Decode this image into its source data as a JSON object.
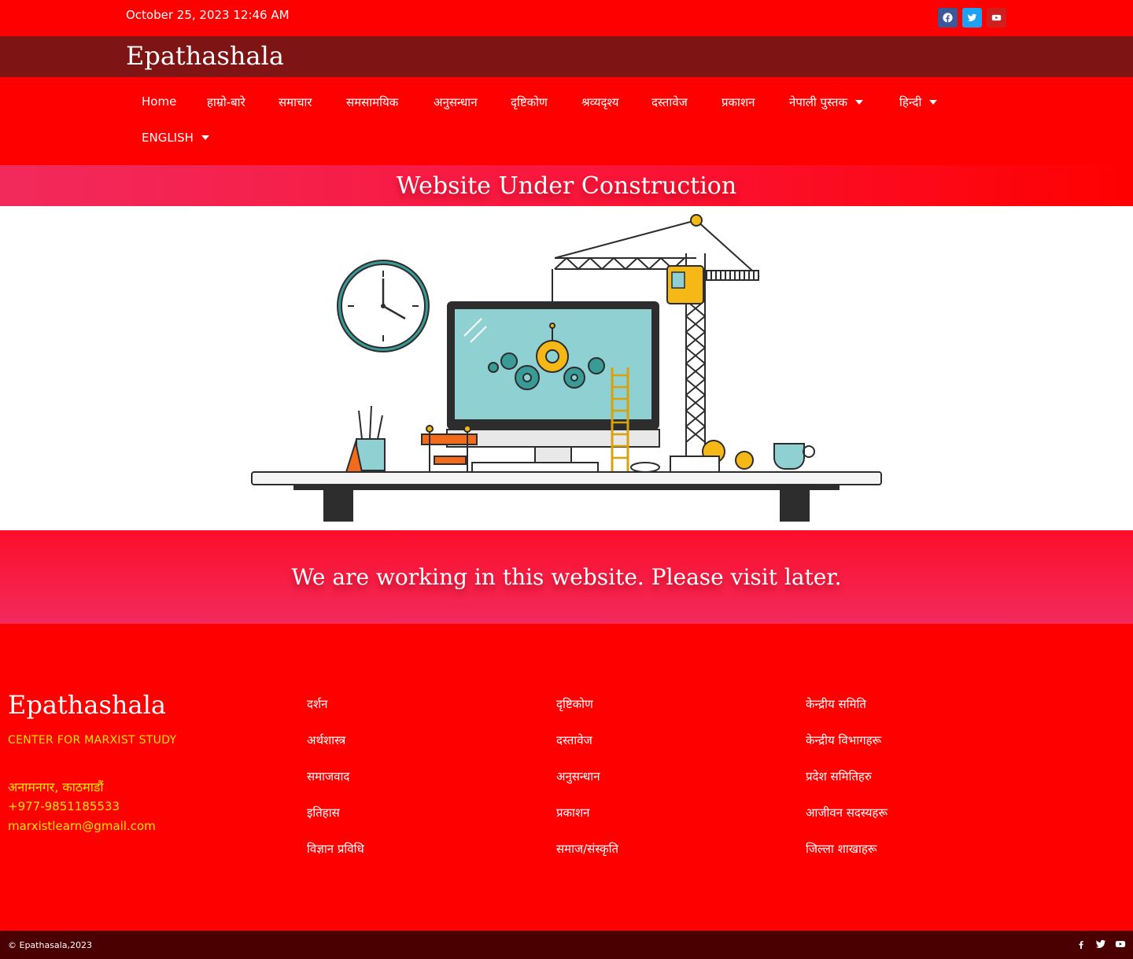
{
  "topbar": {
    "date": "October 25, 2023 12:46 AM",
    "social": [
      {
        "icon": "facebook-icon",
        "color": "#3b5998"
      },
      {
        "icon": "twitter-icon",
        "color": "#1da1f2"
      },
      {
        "icon": "youtube-icon",
        "color": "#cd201f"
      }
    ]
  },
  "site": {
    "name": "Epathashala"
  },
  "nav": {
    "items": [
      {
        "label": "Home"
      },
      {
        "label": "हाम्रो-बारे"
      },
      {
        "label": "समाचार"
      },
      {
        "label": "समसामयिक"
      },
      {
        "label": "अनुसन्धान"
      },
      {
        "label": "दृष्टिकोण"
      },
      {
        "label": "श्रव्यदृश्य"
      },
      {
        "label": "दस्तावेज"
      },
      {
        "label": "प्रकाशन"
      },
      {
        "label": "नेपाली पुस्तक",
        "dropdown": true
      },
      {
        "label": "हिन्दी",
        "dropdown": true
      },
      {
        "label": "ENGLISH",
        "dropdown": true
      }
    ]
  },
  "hero": {
    "title": "Website Under Construction",
    "message": "We are working in this website. Please visit later."
  },
  "footer": {
    "brand": "Epathashala",
    "subtitle": "CENTER FOR MARXIST STUDY",
    "address": "अनामनगर, काठमाडौं",
    "phone": "+977-9851185533",
    "email": "marxistlearn@gmail.com",
    "col1": [
      "दर्शन",
      "अर्थशास्त्र",
      "समाजवाद",
      "इतिहास",
      "विज्ञान प्रविधि"
    ],
    "col2": [
      "दृष्टिकोण",
      "दस्तावेज",
      "अनुसन्धान",
      "प्रकाशन",
      "समाज/संस्कृति"
    ],
    "col3": [
      "केन्द्रीय समिति",
      "केन्द्रीय विभागहरू",
      "प्रदेश समितिहरु",
      "आजीवन सदस्यहरू",
      "जिल्ला शाखाहरू"
    ]
  },
  "bottom": {
    "copyright": "© Epathasala,2023",
    "social": [
      "facebook-icon",
      "twitter-icon",
      "youtube-icon"
    ]
  },
  "colors": {
    "primary_red": "#fe0000",
    "dark_red": "#7f1414",
    "footer_bottom": "#4a0000",
    "accent_yellow": "#ffe500"
  }
}
